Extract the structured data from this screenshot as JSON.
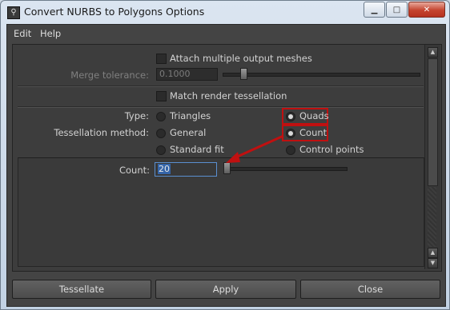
{
  "window": {
    "title": "Convert NURBS to Polygons Options"
  },
  "menu": {
    "items": [
      "Edit",
      "Help"
    ]
  },
  "options": {
    "attach_label": "Attach multiple output meshes",
    "merge_label": "Merge tolerance:",
    "merge_value": "0.1000",
    "match_label": "Match render tessellation",
    "type_label": "Type:",
    "type_triangles": "Triangles",
    "type_quads": "Quads",
    "type_selected": "Quads",
    "method_label": "Tessellation method:",
    "method_general": "General",
    "method_count": "Count",
    "method_standard": "Standard fit",
    "method_control": "Control points",
    "method_selected": "Count",
    "count_label": "Count:",
    "count_value": "20"
  },
  "buttons": {
    "tessellate": "Tessellate",
    "apply": "Apply",
    "close": "Close"
  },
  "colors": {
    "highlight": "#c01010",
    "selection": "#3565a9"
  }
}
